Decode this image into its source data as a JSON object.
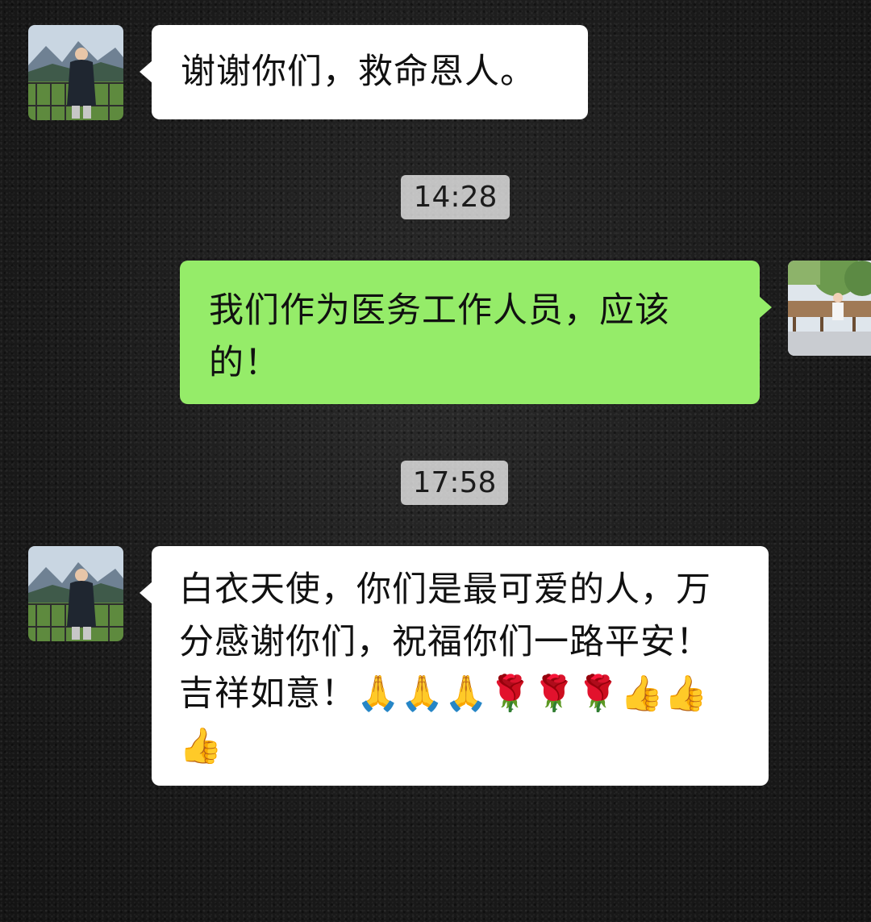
{
  "messages": [
    {
      "side": "left",
      "text": "谢谢你们，救命恩人。"
    },
    {
      "side": "right",
      "text": "我们作为医务工作人员，应该的！"
    },
    {
      "side": "left",
      "text": "白衣天使，你们是最可爱的人，万分感谢你们，祝福你们一路平安！吉祥如意！🙏🙏🙏🌹🌹🌹👍👍👍"
    }
  ],
  "timestamps": [
    "14:28",
    "17:58"
  ],
  "colors": {
    "incoming_bubble": "#ffffff",
    "outgoing_bubble": "#95ec69",
    "background": "#1b1b1b"
  },
  "icons": {
    "avatar_left": "avatar-mountain-photo",
    "avatar_right": "avatar-park-photo"
  }
}
